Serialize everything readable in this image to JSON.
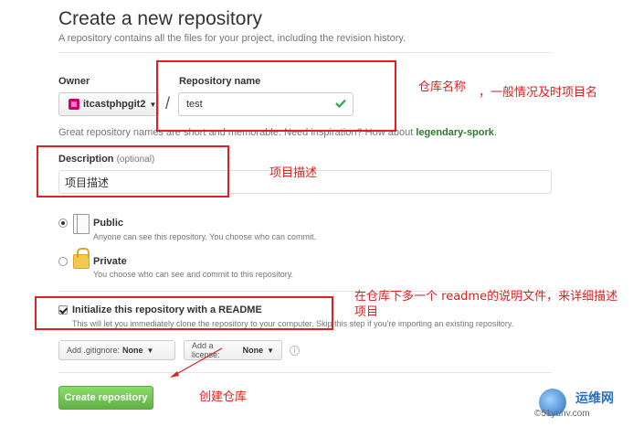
{
  "header": {
    "title": "Create a new repository",
    "subtitle": "A repository contains all the files for your project, including the revision history."
  },
  "owner": {
    "label": "Owner",
    "value": "itcastphpgit2"
  },
  "separator": "/",
  "repo_name": {
    "label": "Repository name",
    "value": "test"
  },
  "hint": {
    "prefix": "Great repository names are short and memorable. Need inspiration? How about ",
    "suggestion": "legendary-spork",
    "suffix": "."
  },
  "description": {
    "label": "Description",
    "optional": "(optional)",
    "value": "项目描述"
  },
  "visibility": {
    "public_title": "Public",
    "public_desc": "Anyone can see this repository. You choose who can commit.",
    "private_title": "Private",
    "private_desc": "You choose who can see and commit to this repository.",
    "selected": "Public"
  },
  "readme": {
    "title": "Initialize this repository with a README",
    "desc": "This will let you immediately clone the repository to your computer. Skip this step if you're importing an existing repository.",
    "checked": true
  },
  "gitignore": {
    "label": "Add .gitignore:",
    "value": "None"
  },
  "license": {
    "label": "Add a license:",
    "value": "None"
  },
  "info_glyph": "i",
  "create_button": "Create repository",
  "annotations": {
    "repo_name": "仓库名称",
    "repo_name_2": "，一般情况及时项目名",
    "description": "项目描述",
    "readme": "在仓库下多一个   readme的说明文件，来详细描述项目",
    "create": "创建仓库"
  },
  "watermark": {
    "name": "运维网",
    "url": "©51yunv.com"
  },
  "colors": {
    "annotation": "#e02020",
    "create_button": "#60b044",
    "suggestion": "#2d7a2d"
  }
}
